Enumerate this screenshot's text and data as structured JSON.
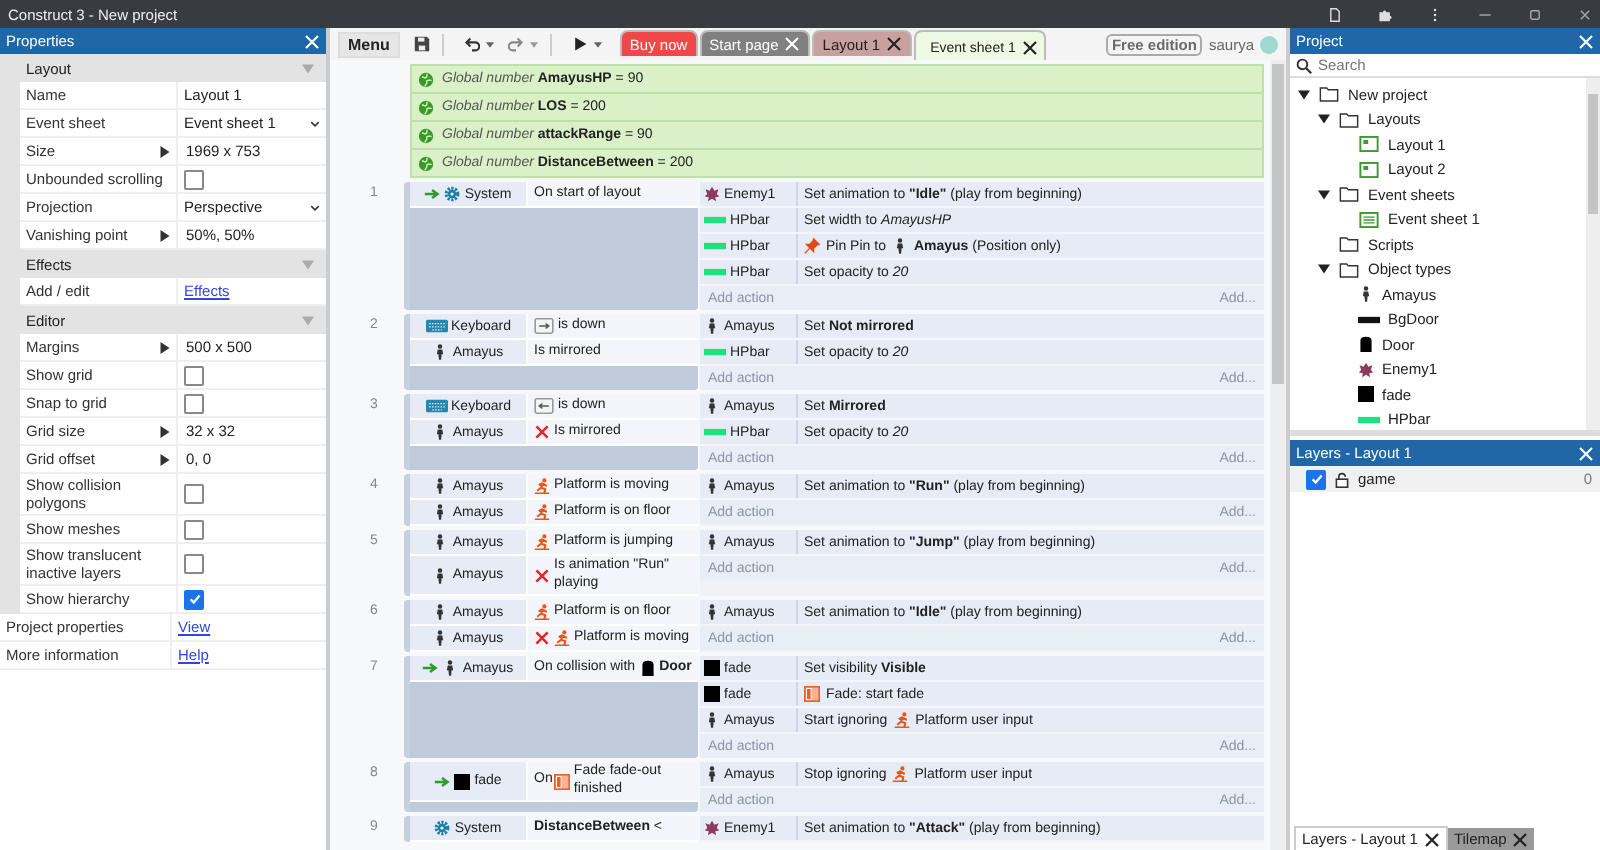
{
  "window": {
    "title": "Construct 3 - New project"
  },
  "properties": {
    "title": "Properties",
    "sections": [
      {
        "title": "Layout",
        "rows": [
          {
            "label": "Name",
            "kind": "text",
            "value": "Layout 1"
          },
          {
            "label": "Event sheet",
            "kind": "dropdown",
            "value": "Event sheet 1"
          },
          {
            "label": "Size",
            "kind": "expand",
            "value": "1969 x 753"
          },
          {
            "label": "Unbounded scrolling",
            "kind": "checkbox",
            "checked": false
          },
          {
            "label": "Projection",
            "kind": "dropdown",
            "value": "Perspective"
          },
          {
            "label": "Vanishing point",
            "kind": "expand",
            "value": "50%, 50%"
          }
        ]
      },
      {
        "title": "Effects",
        "rows": [
          {
            "label": "Add / edit",
            "kind": "link",
            "value": "Effects"
          }
        ]
      },
      {
        "title": "Editor",
        "rows": [
          {
            "label": "Margins",
            "kind": "expand",
            "value": "500 x 500"
          },
          {
            "label": "Show grid",
            "kind": "checkbox",
            "checked": false
          },
          {
            "label": "Snap to grid",
            "kind": "checkbox",
            "checked": false
          },
          {
            "label": "Grid size",
            "kind": "expand",
            "value": "32 x 32"
          },
          {
            "label": "Grid offset",
            "kind": "expand",
            "value": "0, 0"
          },
          {
            "label": "Show collision polygons",
            "kind": "checkbox",
            "checked": false
          },
          {
            "label": "Show meshes",
            "kind": "checkbox",
            "checked": false
          },
          {
            "label": "Show translucent inactive layers",
            "kind": "checkbox",
            "checked": false
          },
          {
            "label": "Show hierarchy",
            "kind": "checkbox",
            "checked": true
          }
        ]
      }
    ],
    "footer": [
      {
        "label": "Project properties",
        "kind": "link",
        "value": "View"
      },
      {
        "label": "More information",
        "kind": "link",
        "value": "Help"
      }
    ]
  },
  "toolbar": {
    "menu": "Menu",
    "tabs": [
      {
        "label": "Buy now",
        "kind": "promo",
        "selected": false
      },
      {
        "label": "Start page",
        "kind": "start",
        "selected": false
      },
      {
        "label": "Layout 1",
        "kind": "layout",
        "selected": false
      },
      {
        "label": "Event sheet 1",
        "kind": "sheet",
        "selected": true
      }
    ],
    "edition": "Free edition",
    "user": "saurya"
  },
  "globals": [
    {
      "type": "Global number",
      "name": "AmayusHP",
      "value": "= 90"
    },
    {
      "type": "Global number",
      "name": "LOS",
      "value": "= 200"
    },
    {
      "type": "Global number",
      "name": "attackRange",
      "value": "= 90"
    },
    {
      "type": "Global number",
      "name": "DistanceBetween",
      "value": "= 200"
    }
  ],
  "events": [
    {
      "number": "1",
      "trigger": true,
      "conditions": [
        {
          "object": "System",
          "kind": "system",
          "inverted": false,
          "segments": [
            {
              "kind": "text",
              "text": "On start of layout"
            }
          ]
        }
      ],
      "actions": [
        {
          "object": "Enemy1",
          "kind": "enemy",
          "segments": [
            {
              "kind": "text",
              "text": "Set animation to **\"Idle\"** (play from beginning)"
            }
          ]
        },
        {
          "object": "HPbar",
          "kind": "bar",
          "segments": [
            {
              "kind": "text",
              "text": "Set width to *AmayusHP*"
            }
          ]
        },
        {
          "object": "HPbar",
          "kind": "bar",
          "segments": [
            {
              "kind": "pin"
            },
            {
              "kind": "text",
              "text": "Pin Pin to"
            },
            {
              "kind": "person"
            },
            {
              "kind": "text",
              "text": "**Amayus** (Position only)"
            }
          ]
        },
        {
          "object": "HPbar",
          "kind": "bar",
          "segments": [
            {
              "kind": "text",
              "text": "Set opacity to *20*"
            }
          ]
        }
      ],
      "add_action": "Add action",
      "add_more": "Add..."
    },
    {
      "number": "2",
      "trigger": false,
      "conditions": [
        {
          "object": "Keyboard",
          "kind": "keyboard",
          "inverted": false,
          "segments": [
            {
              "kind": "right-key"
            },
            {
              "kind": "text",
              "text": "is down"
            }
          ]
        },
        {
          "object": "Amayus",
          "kind": "person",
          "inverted": false,
          "segments": [
            {
              "kind": "text",
              "text": "Is mirrored"
            }
          ]
        }
      ],
      "actions": [
        {
          "object": "Amayus",
          "kind": "person",
          "segments": [
            {
              "kind": "text",
              "text": "Set **Not mirrored**"
            }
          ]
        },
        {
          "object": "HPbar",
          "kind": "bar",
          "segments": [
            {
              "kind": "text",
              "text": "Set opacity to *20*"
            }
          ]
        }
      ],
      "add_action": "Add action",
      "add_more": "Add..."
    },
    {
      "number": "3",
      "trigger": false,
      "conditions": [
        {
          "object": "Keyboard",
          "kind": "keyboard",
          "inverted": false,
          "segments": [
            {
              "kind": "left-key"
            },
            {
              "kind": "text",
              "text": "is down"
            }
          ]
        },
        {
          "object": "Amayus",
          "kind": "person",
          "inverted": true,
          "segments": [
            {
              "kind": "text",
              "text": "Is mirrored"
            }
          ]
        }
      ],
      "actions": [
        {
          "object": "Amayus",
          "kind": "person",
          "segments": [
            {
              "kind": "text",
              "text": "Set **Mirrored**"
            }
          ]
        },
        {
          "object": "HPbar",
          "kind": "bar",
          "segments": [
            {
              "kind": "text",
              "text": "Set opacity to *20*"
            }
          ]
        }
      ],
      "add_action": "Add action",
      "add_more": "Add..."
    },
    {
      "number": "4",
      "trigger": false,
      "conditions": [
        {
          "object": "Amayus",
          "kind": "person",
          "inverted": false,
          "segments": [
            {
              "kind": "platform"
            },
            {
              "kind": "text",
              "text": "Platform is moving"
            }
          ]
        },
        {
          "object": "Amayus",
          "kind": "person",
          "inverted": false,
          "segments": [
            {
              "kind": "platform"
            },
            {
              "kind": "text",
              "text": "Platform is on floor"
            }
          ]
        }
      ],
      "actions": [
        {
          "object": "Amayus",
          "kind": "person",
          "segments": [
            {
              "kind": "text",
              "text": "Set animation to **\"Run\"** (play from beginning)"
            }
          ]
        }
      ],
      "add_action": "Add action",
      "add_more": "Add..."
    },
    {
      "number": "5",
      "trigger": false,
      "conditions": [
        {
          "object": "Amayus",
          "kind": "person",
          "inverted": false,
          "segments": [
            {
              "kind": "platform"
            },
            {
              "kind": "text",
              "text": "Platform is jumping"
            }
          ]
        },
        {
          "object": "Amayus",
          "kind": "person",
          "inverted": true,
          "segments": [
            {
              "kind": "text",
              "text": "Is animation \"Run\" playing"
            }
          ]
        }
      ],
      "actions": [
        {
          "object": "Amayus",
          "kind": "person",
          "segments": [
            {
              "kind": "text",
              "text": "Set animation to **\"Jump\"** (play from beginning)"
            }
          ]
        }
      ],
      "add_action": "Add action",
      "add_more": "Add..."
    },
    {
      "number": "6",
      "trigger": false,
      "conditions": [
        {
          "object": "Amayus",
          "kind": "person",
          "inverted": false,
          "segments": [
            {
              "kind": "platform"
            },
            {
              "kind": "text",
              "text": "Platform is on floor"
            }
          ]
        },
        {
          "object": "Amayus",
          "kind": "person",
          "inverted": true,
          "segments": [
            {
              "kind": "platform"
            },
            {
              "kind": "text",
              "text": "Platform is moving"
            }
          ]
        }
      ],
      "actions": [
        {
          "object": "Amayus",
          "kind": "person",
          "segments": [
            {
              "kind": "text",
              "text": "Set animation to **\"Idle\"** (play from beginning)"
            }
          ]
        }
      ],
      "add_action": "Add action",
      "add_more": "Add..."
    },
    {
      "number": "7",
      "trigger": true,
      "conditions": [
        {
          "object": "Amayus",
          "kind": "person",
          "inverted": false,
          "segments": [
            {
              "kind": "text",
              "text": "On collision with"
            },
            {
              "kind": "door"
            },
            {
              "kind": "text",
              "text": "**Door**"
            }
          ]
        }
      ],
      "actions": [
        {
          "object": "fade",
          "kind": "square",
          "segments": [
            {
              "kind": "text",
              "text": "Set visibility **Visible**"
            }
          ]
        },
        {
          "object": "fade",
          "kind": "square",
          "segments": [
            {
              "kind": "fade"
            },
            {
              "kind": "text",
              "text": "Fade: start fade"
            }
          ]
        },
        {
          "object": "Amayus",
          "kind": "person",
          "segments": [
            {
              "kind": "text",
              "text": "Start ignoring"
            },
            {
              "kind": "platform"
            },
            {
              "kind": "text",
              "text": "Platform user input"
            }
          ]
        }
      ],
      "add_action": "Add action",
      "add_more": "Add..."
    },
    {
      "number": "8",
      "trigger": true,
      "conditions": [
        {
          "object": "fade",
          "kind": "square",
          "inverted": false,
          "segments": [
            {
              "kind": "text",
              "text": "On"
            },
            {
              "kind": "fade"
            },
            {
              "kind": "text",
              "text": "Fade fade-out finished"
            }
          ]
        }
      ],
      "actions": [
        {
          "object": "Amayus",
          "kind": "person",
          "segments": [
            {
              "kind": "text",
              "text": "Stop ignoring"
            },
            {
              "kind": "platform"
            },
            {
              "kind": "text",
              "text": "Platform user input"
            }
          ]
        }
      ],
      "add_action": "Add action",
      "add_more": "Add..."
    },
    {
      "number": "9",
      "trigger": false,
      "conditions": [
        {
          "object": "System",
          "kind": "system",
          "inverted": false,
          "segments": [
            {
              "kind": "text",
              "text": "**DistanceBetween** <"
            }
          ]
        }
      ],
      "actions": [
        {
          "object": "Enemy1",
          "kind": "enemy",
          "segments": [
            {
              "kind": "text",
              "text": "Set animation to **\"Attack\"** (play from beginning)"
            }
          ]
        }
      ]
    }
  ],
  "project": {
    "title": "Project",
    "search_placeholder": "Search",
    "tree": [
      {
        "label": "New project",
        "kind": "folder",
        "expanded": true,
        "children": [
          {
            "label": "Layouts",
            "kind": "folder",
            "expanded": true,
            "children": [
              {
                "label": "Layout 1",
                "kind": "layout"
              },
              {
                "label": "Layout 2",
                "kind": "layout"
              }
            ]
          },
          {
            "label": "Event sheets",
            "kind": "folder",
            "expanded": true,
            "children": [
              {
                "label": "Event sheet 1",
                "kind": "sheet"
              }
            ]
          },
          {
            "label": "Scripts",
            "kind": "folder"
          },
          {
            "label": "Object types",
            "kind": "folder",
            "expanded": true,
            "children": [
              {
                "label": "Amayus",
                "kind": "person"
              },
              {
                "label": "BgDoor",
                "kind": "wide-bar"
              },
              {
                "label": "Door",
                "kind": "door"
              },
              {
                "label": "Enemy1",
                "kind": "enemy"
              },
              {
                "label": "fade",
                "kind": "square"
              },
              {
                "label": "HPbar",
                "kind": "bar"
              }
            ]
          }
        ]
      }
    ]
  },
  "layers": {
    "title": "Layers - Layout 1",
    "items": [
      {
        "name": "game",
        "visible": true,
        "locked": false,
        "index": "0"
      }
    ],
    "tabs": [
      {
        "label": "Layers - Layout 1",
        "selected": true
      },
      {
        "label": "Tilemap",
        "selected": false
      }
    ]
  }
}
